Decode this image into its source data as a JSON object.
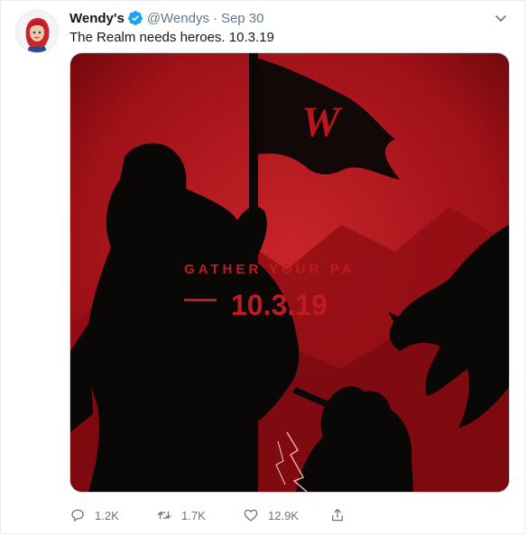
{
  "tweet": {
    "display_name": "Wendy's",
    "handle": "@Wendys",
    "separator": "·",
    "date": "Sep 30",
    "text": "The Realm needs heroes. 10.3.19",
    "media": {
      "flag_letter": "W",
      "headline": "GATHER YOUR PA",
      "date_line": "10.3.19",
      "colors": {
        "red": "#b5141b",
        "dark": "#0a0707",
        "accent": "#c01a22"
      }
    },
    "actions": {
      "replies": "1.2K",
      "retweets": "1.7K",
      "likes": "12.9K"
    },
    "icons": [
      "verified-badge-icon",
      "chevron-down-icon",
      "reply-icon",
      "retweet-icon",
      "like-icon",
      "share-icon"
    ]
  }
}
